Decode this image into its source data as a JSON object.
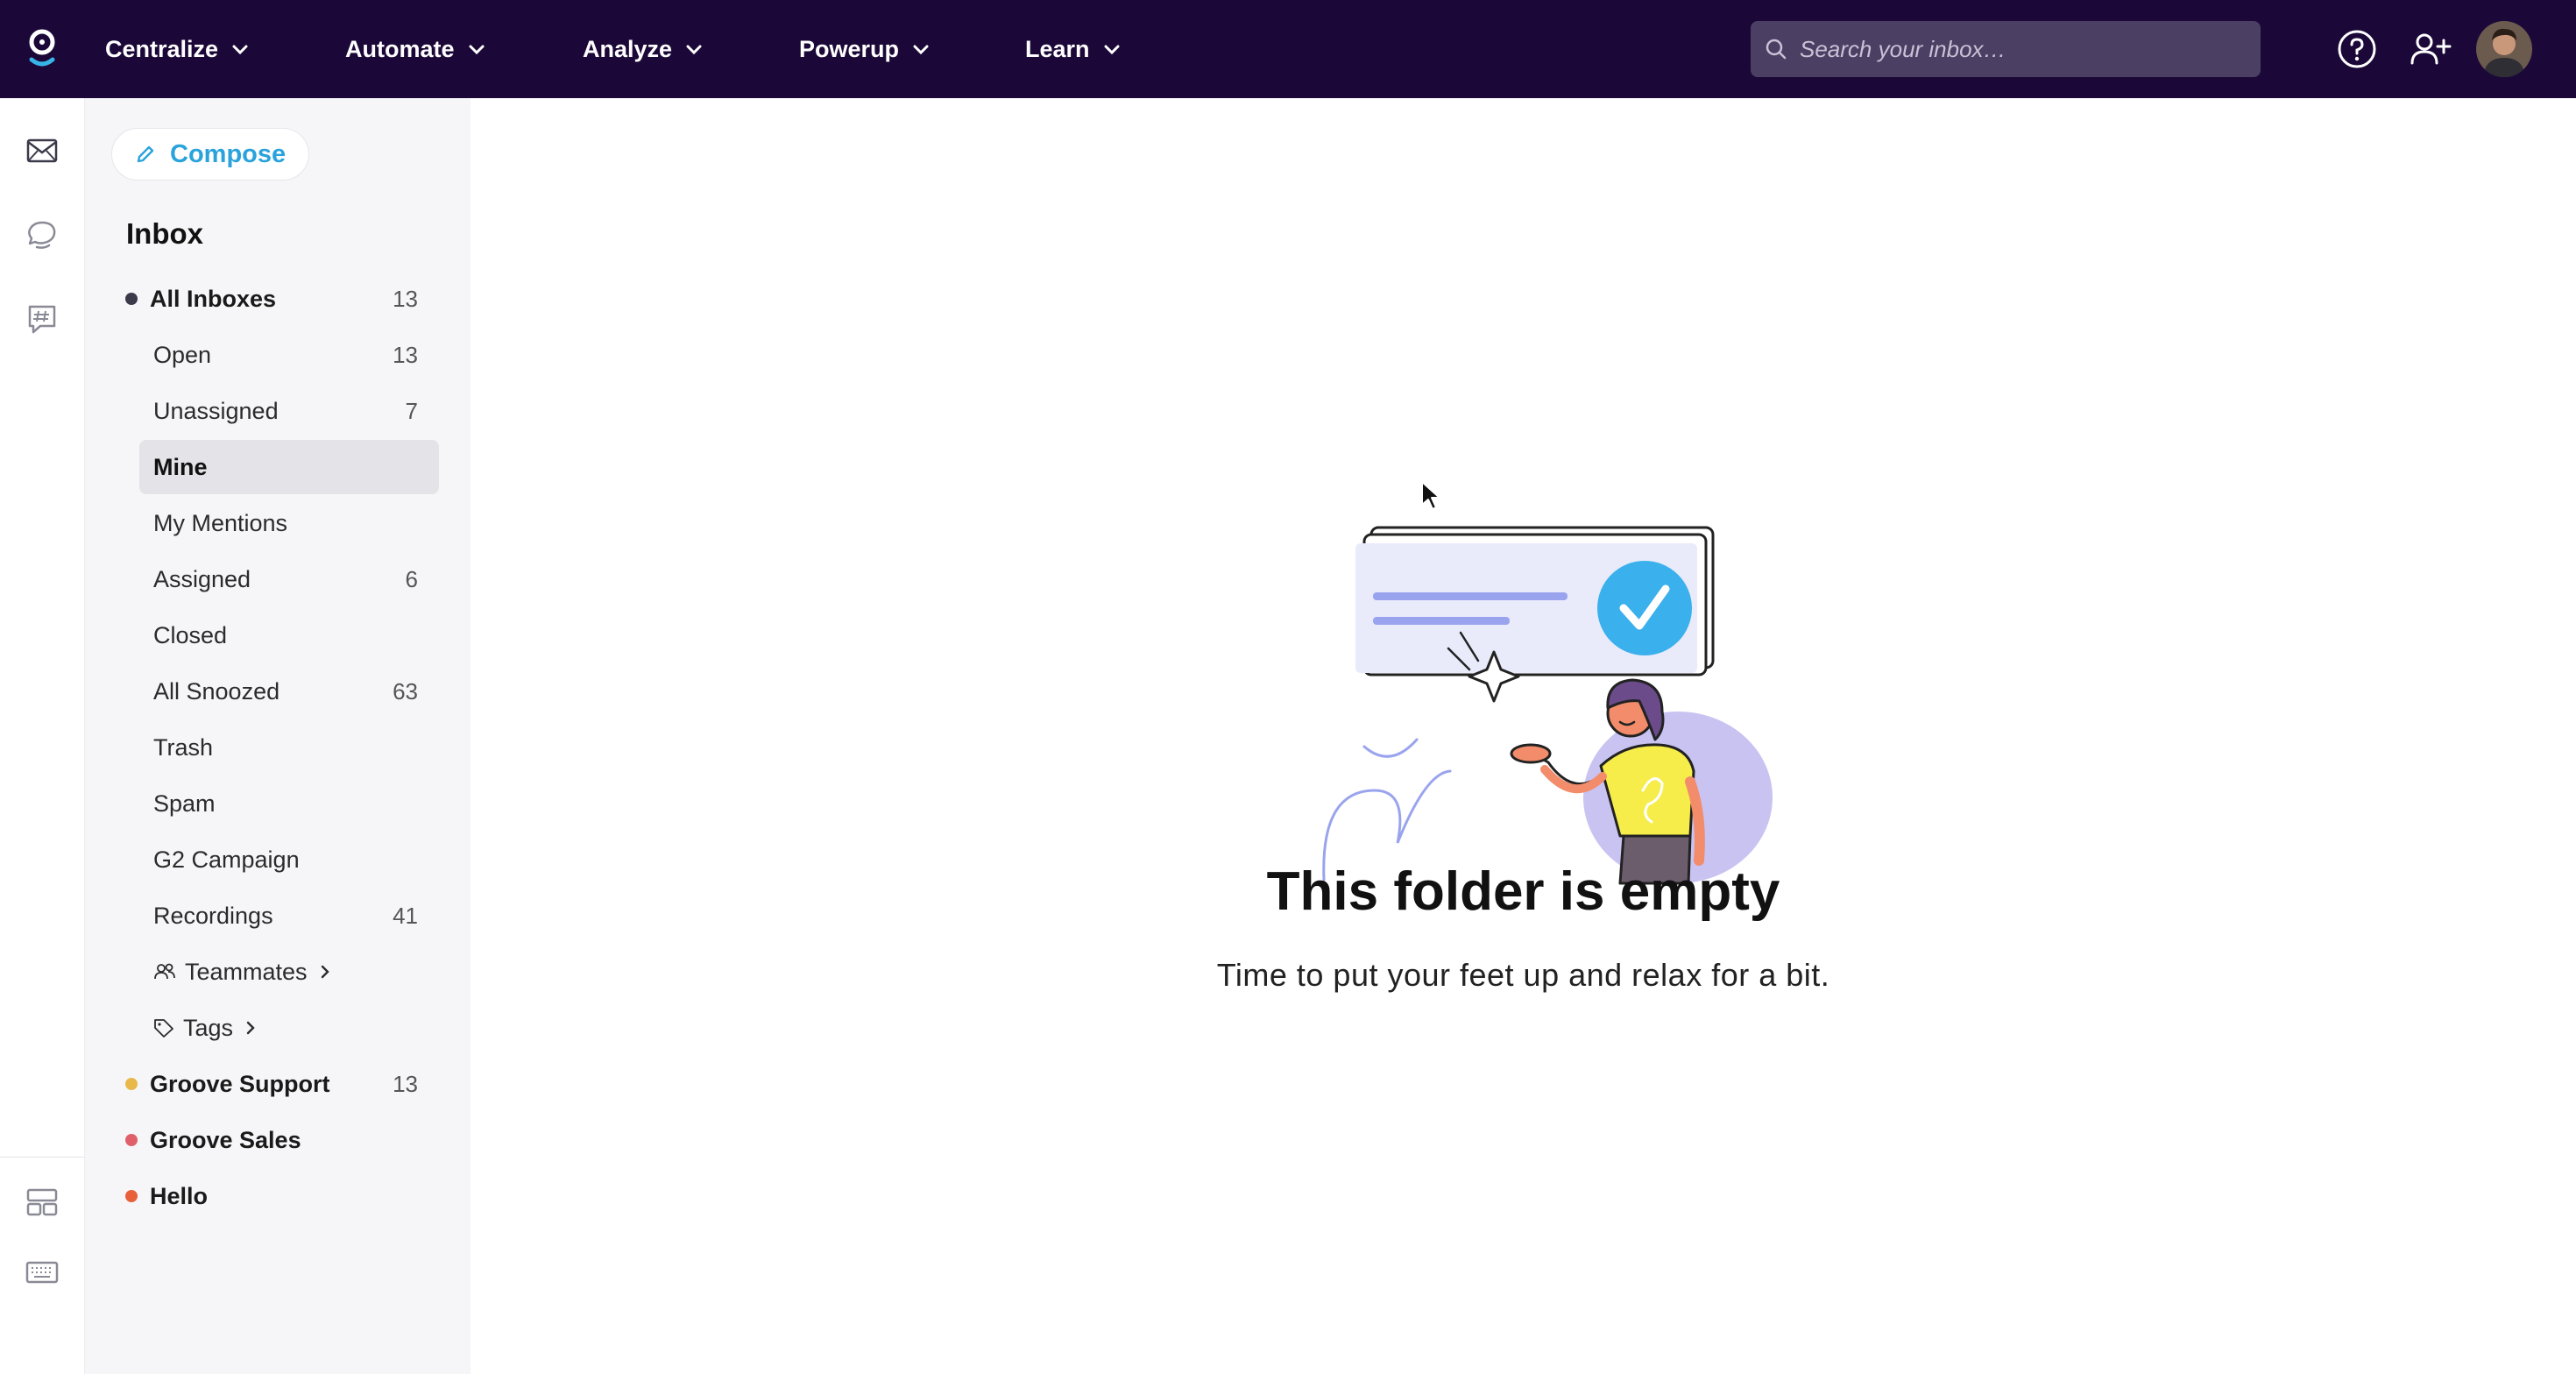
{
  "topbar": {
    "background": "#1b0838",
    "nav": [
      {
        "label": "Centralize",
        "icon": "chevron-down-icon"
      },
      {
        "label": "Automate",
        "icon": "chevron-down-icon"
      },
      {
        "label": "Analyze",
        "icon": "chevron-down-icon"
      },
      {
        "label": "Powerup",
        "icon": "chevron-down-icon"
      },
      {
        "label": "Learn",
        "icon": "chevron-down-icon"
      }
    ],
    "search": {
      "placeholder": "Search your inbox…",
      "value": ""
    },
    "icons": [
      "help-icon",
      "add-user-icon",
      "avatar"
    ]
  },
  "rail": {
    "icons": [
      "mail-icon",
      "chat-icon",
      "hashtag-chat-icon",
      "layout-icon",
      "keyboard-icon"
    ]
  },
  "sidebar": {
    "compose_label": "Compose",
    "heading": "Inbox",
    "all_inboxes": {
      "label": "All Inboxes",
      "count": "13",
      "color": "#3a3a4a"
    },
    "folders": [
      {
        "label": "Open",
        "count": "13"
      },
      {
        "label": "Unassigned",
        "count": "7"
      },
      {
        "label": "Mine",
        "count": "",
        "selected": true
      },
      {
        "label": "My Mentions",
        "count": ""
      },
      {
        "label": "Assigned",
        "count": "6"
      },
      {
        "label": "Closed",
        "count": ""
      },
      {
        "label": "All Snoozed",
        "count": "63"
      },
      {
        "label": "Trash",
        "count": ""
      },
      {
        "label": "Spam",
        "count": ""
      },
      {
        "label": "G2 Campaign",
        "count": ""
      },
      {
        "label": "Recordings",
        "count": "41"
      },
      {
        "label": "Teammates",
        "count": ""
      },
      {
        "label": "Tags",
        "count": ""
      }
    ],
    "inboxes": [
      {
        "label": "Groove Support",
        "count": "13",
        "color": "#e8b84a"
      },
      {
        "label": "Groove Sales",
        "count": "",
        "color": "#e0606a"
      },
      {
        "label": "Hello",
        "count": "",
        "color": "#e8603a"
      }
    ]
  },
  "main": {
    "empty_title": "This folder is empty",
    "empty_subtitle": "Time to put your feet up and relax for a bit."
  },
  "colors": {
    "accent": "#2aa3dc",
    "selected_bg": "#e4e4e8",
    "sidebar_bg": "#f6f6f8"
  }
}
